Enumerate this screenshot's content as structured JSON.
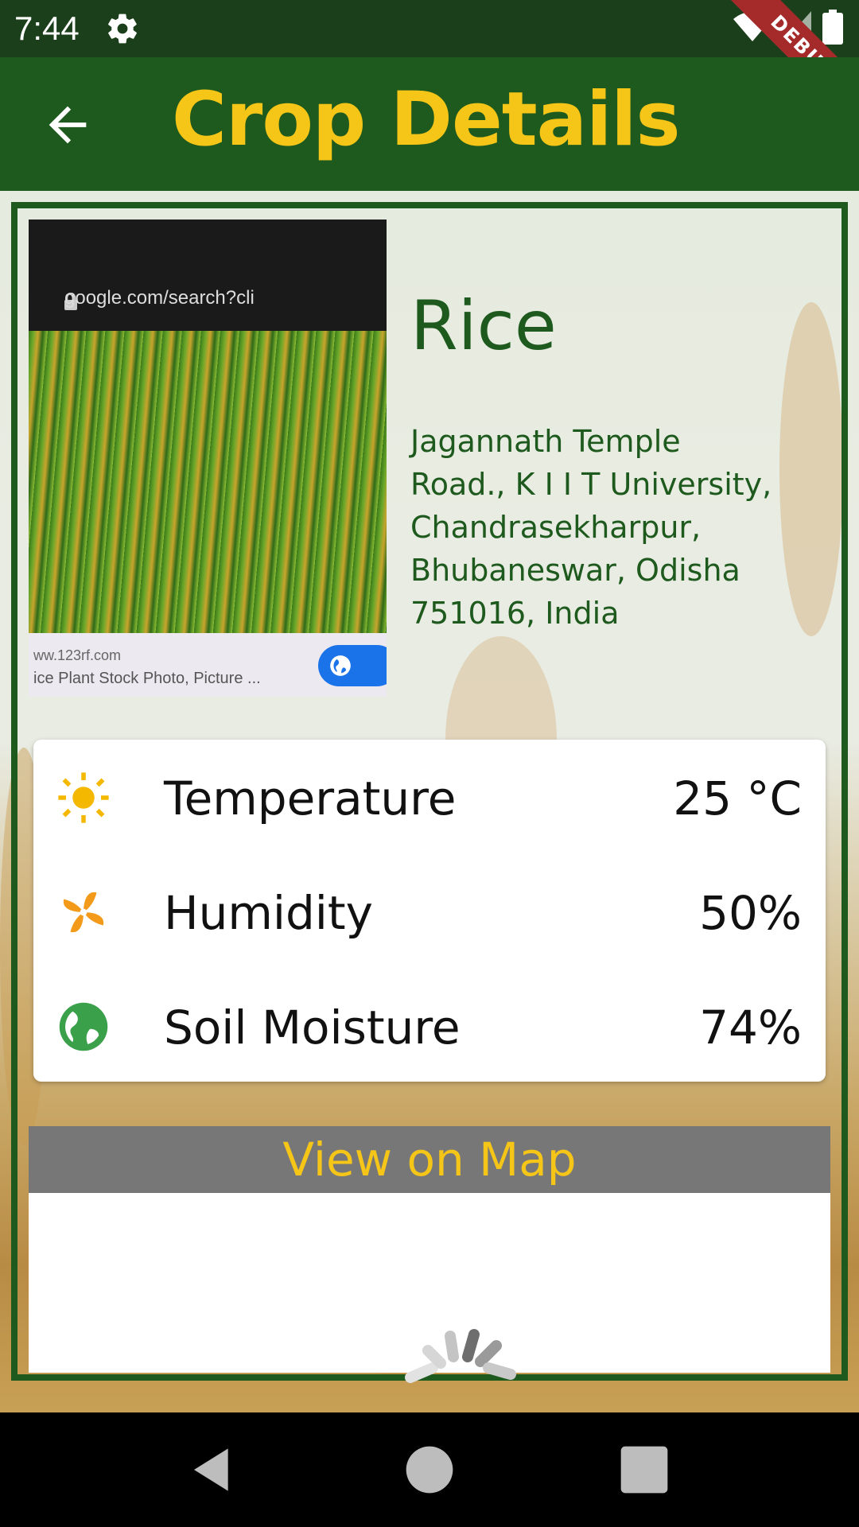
{
  "status_bar": {
    "time": "7:44",
    "debug_label": "DEBUG",
    "icons": [
      "gear-icon",
      "wifi-icon",
      "signal-icon",
      "battery-icon"
    ]
  },
  "app_bar": {
    "title": "Crop Details",
    "back_icon": "arrow-left-icon"
  },
  "crop": {
    "photo": {
      "url_text": "google.com/search?cli",
      "source_text": "ww.123rf.com",
      "caption_text": "ice Plant Stock Photo, Picture ..."
    },
    "name": "Rice",
    "address": "Jagannath Temple Road., K I I T University, Chandrasekharpur, Bhubaneswar, Odisha 751016, India"
  },
  "metrics": [
    {
      "icon": "sun-icon",
      "label": "Temperature",
      "value": "25 °C",
      "icon_color": "#f5b800"
    },
    {
      "icon": "fan-icon",
      "label": "Humidity",
      "value": "50%",
      "icon_color": "#f39a1a"
    },
    {
      "icon": "globe-icon",
      "label": "Soil Moisture",
      "value": "74%",
      "icon_color": "#3aa04a"
    }
  ],
  "map": {
    "button_label": "View on Map"
  },
  "colors": {
    "primary_green": "#1e5a1e",
    "accent_yellow": "#f5c518",
    "map_header_gray": "#777777"
  },
  "nav_bar": {
    "icons": [
      "back-triangle-icon",
      "home-circle-icon",
      "recents-square-icon"
    ]
  }
}
